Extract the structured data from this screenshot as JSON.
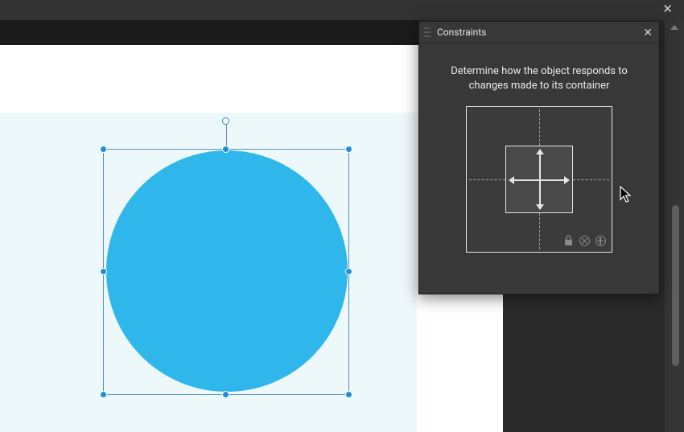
{
  "app": {
    "close_glyph": "✕"
  },
  "panel": {
    "title": "Constraints",
    "close_glyph": "✕",
    "description_line1": "Determine how the object responds to",
    "description_line2": "changes made to its container"
  },
  "constraints": {
    "pin_left": false,
    "pin_right": false,
    "pin_top": false,
    "pin_bottom": false,
    "flex_width": true,
    "flex_height": true
  },
  "selection": {
    "shape": "circle",
    "fill": "#2fb6ea"
  }
}
